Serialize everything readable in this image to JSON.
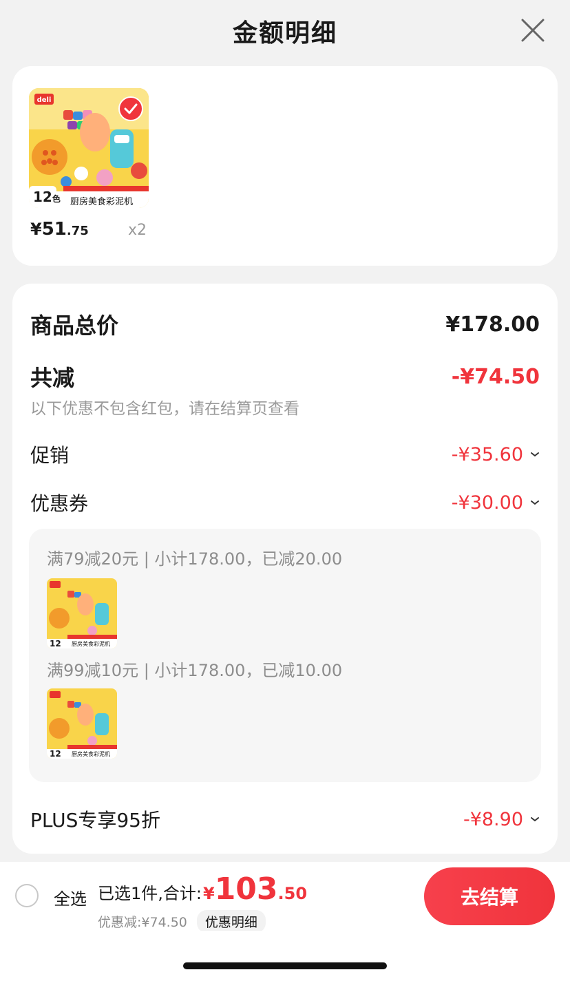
{
  "header": {
    "title": "金额明细"
  },
  "product": {
    "thumb_badge_text": "12",
    "thumb_badge_unit": "色",
    "thumb_name": "厨房美食彩泥机",
    "thumb_brand": "deli",
    "price_symbol": "¥",
    "price_int": "51",
    "price_dec": ".75",
    "quantity": "x2"
  },
  "summary": {
    "total_label": "商品总价",
    "total_value": "¥178.00",
    "reduce_label": "共减",
    "reduce_value": "-¥74.50",
    "note": "以下优惠不包含红包，请在结算页查看",
    "promo_label": "促销",
    "promo_value": "-¥35.60",
    "coupon_label": "优惠券",
    "coupon_value": "-¥30.00",
    "coupon_items": [
      {
        "text": "满79减20元 | 小计178.00，已减20.00"
      },
      {
        "text": "满99减10元 | 小计178.00，已减10.00"
      }
    ],
    "plus_label": "PLUS专享95折",
    "plus_value": "-¥8.90"
  },
  "bottom": {
    "select_all": "全选",
    "total_prefix": "已选1件,合计:",
    "total_symbol": "¥",
    "total_int": "103",
    "total_dec": ".50",
    "discount_text": "优惠减:¥74.50",
    "detail_chip": "优惠明细",
    "checkout": "去结算"
  },
  "colors": {
    "accent": "#f0343c",
    "background": "#f2f2f2"
  }
}
